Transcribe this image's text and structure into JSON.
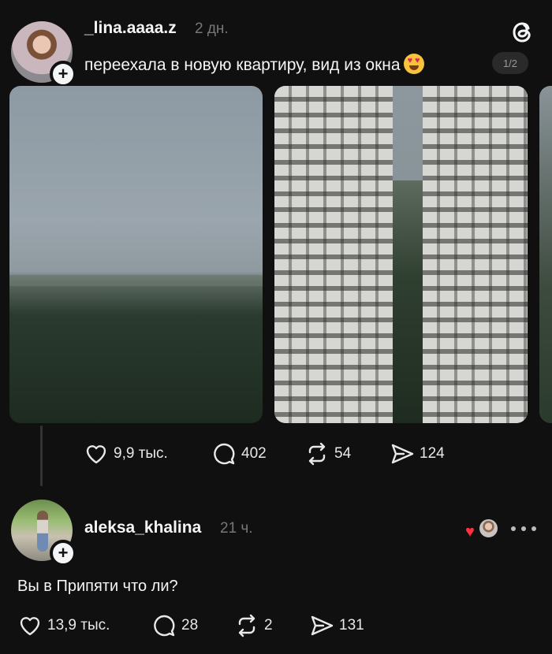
{
  "post": {
    "username": "_lina.aaaa.z",
    "time": "2 дн.",
    "text": "переехала в новую квартиру, вид из окна",
    "emoji": "heart-eyes-emoji",
    "page_indicator": "1/2",
    "stats": {
      "likes": "9,9 тыс.",
      "replies": "402",
      "reposts": "54",
      "shares": "124"
    }
  },
  "reply": {
    "username": "aleksa_khalina",
    "time": "21 ч.",
    "text": "Вы в Припяти что ли?",
    "stats": {
      "likes": "13,9 тыс.",
      "replies": "28",
      "reposts": "2",
      "shares": "131"
    }
  },
  "colors": {
    "background": "#101010",
    "text": "#f3f5f7",
    "muted": "#777777",
    "like_accent": "#ff3040"
  },
  "icons": [
    "threads-logo-icon",
    "plus-icon",
    "heart-icon",
    "comment-icon",
    "repost-icon",
    "share-icon",
    "more-icon"
  ]
}
